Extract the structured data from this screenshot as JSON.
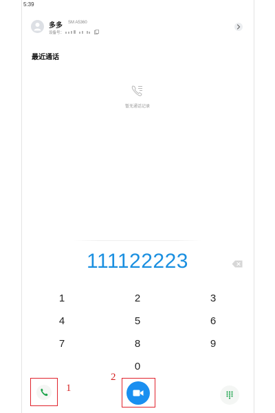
{
  "status_bar": {
    "time": "5:39"
  },
  "contact": {
    "name": "多多",
    "model": "SM A5360",
    "device_label": "设备号："
  },
  "recent_calls": {
    "title": "最近通话",
    "empty_text": "暂无通话记录"
  },
  "dialer": {
    "number": "111122223",
    "keys": [
      "1",
      "2",
      "3",
      "4",
      "5",
      "6",
      "7",
      "8",
      "9",
      "0"
    ]
  },
  "annotations": {
    "one": "1",
    "two": "2"
  },
  "colors": {
    "accent": "#1a8fe0",
    "call_green": "#1aa34a",
    "annotation_red": "#e0202a"
  }
}
